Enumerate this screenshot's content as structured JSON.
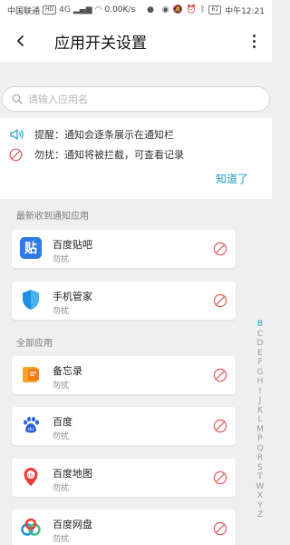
{
  "status_bar": {
    "carrier": "中国联通",
    "network_badge": "HD",
    "net_type": "4G",
    "speed": "0.00K/s",
    "battery": "61",
    "time": "中午12:21"
  },
  "header": {
    "title": "应用开关设置"
  },
  "search": {
    "placeholder": "请输入应用名",
    "value": ""
  },
  "tips": {
    "remind": "提醒：通知会逐条展示在通知栏",
    "disturb": "勿扰：通知将被拦截，可查看记录",
    "got_it": "知道了"
  },
  "sections": {
    "recent": "最新收到通知应用",
    "all": "全部应用"
  },
  "recent_apps": [
    {
      "name": "百度贴吧",
      "status": "勿扰",
      "icon": "baidu-tieba-icon"
    },
    {
      "name": "手机管家",
      "status": "勿扰",
      "icon": "phone-manager-icon"
    }
  ],
  "all_apps": [
    {
      "name": "备忘录",
      "status": "勿扰",
      "icon": "memo-icon"
    },
    {
      "name": "百度",
      "status": "勿扰",
      "icon": "baidu-icon"
    },
    {
      "name": "百度地图",
      "status": "勿扰",
      "icon": "baidu-map-icon"
    },
    {
      "name": "百度网盘",
      "status": "勿扰",
      "icon": "baidu-netdisk-icon"
    }
  ],
  "az_index": [
    "B",
    "C",
    "D",
    "E",
    "F",
    "G",
    "H",
    "I",
    "J",
    "K",
    "L",
    "M",
    "P",
    "Q",
    "R",
    "S",
    "T",
    "W",
    "X",
    "Y",
    "Z"
  ],
  "az_active": "B",
  "colors": {
    "accent": "#1e9ccf",
    "block_red": "#e05a5a"
  }
}
